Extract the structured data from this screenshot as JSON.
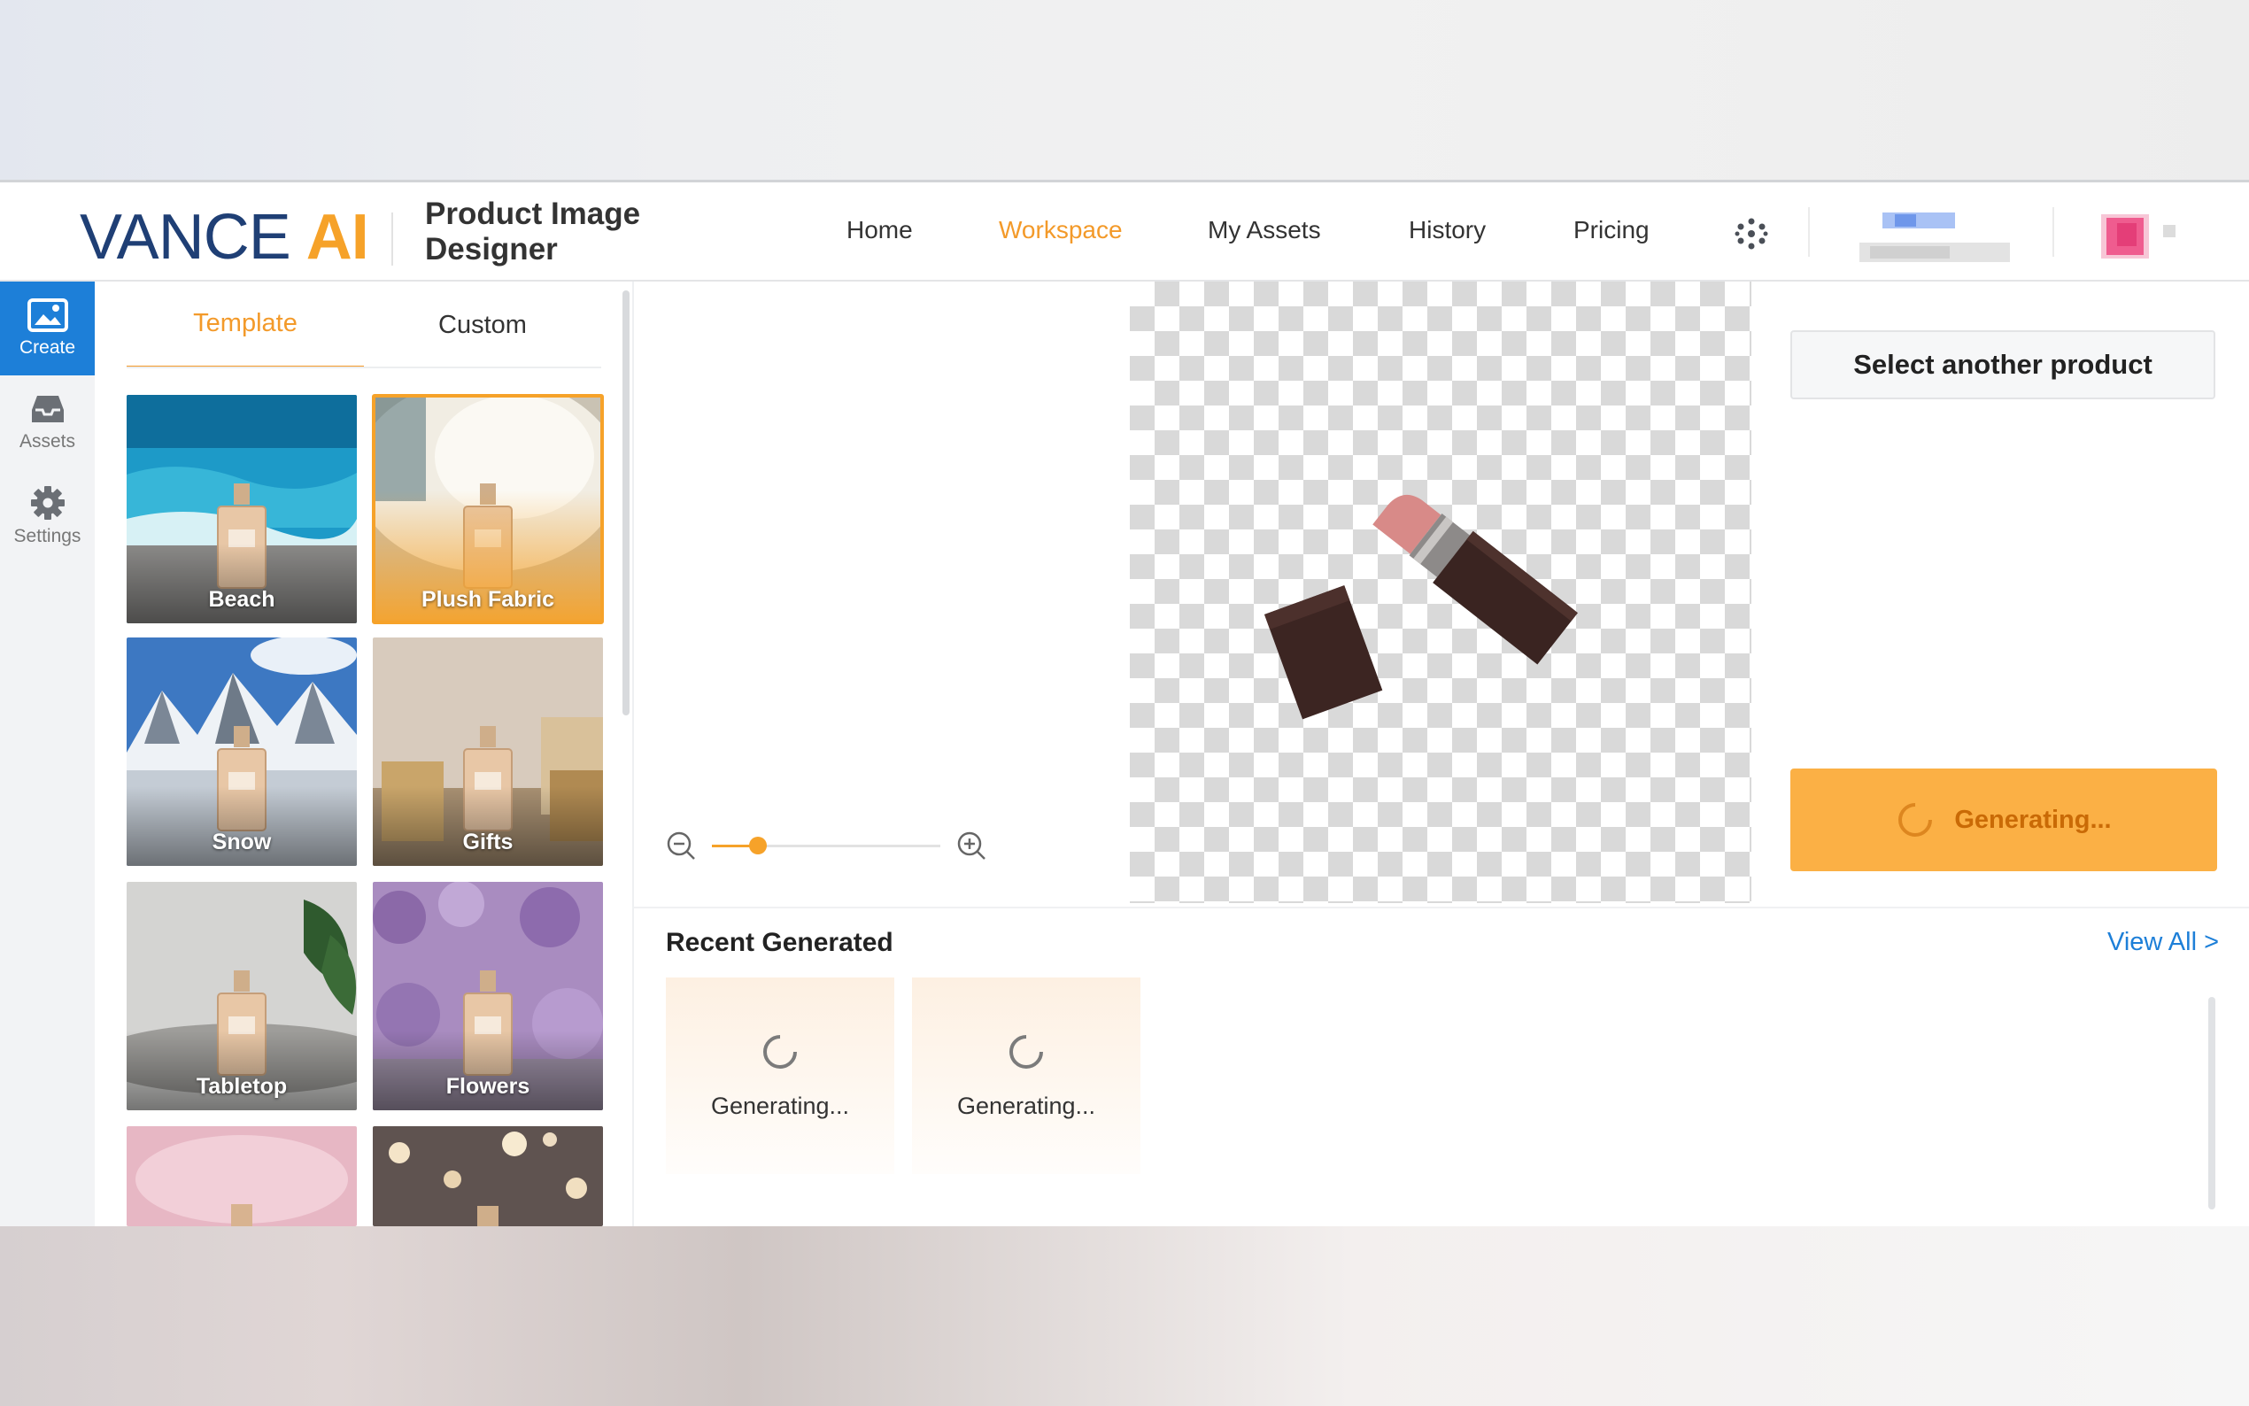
{
  "header": {
    "logo_main": "VANCE",
    "logo_accent": "AI",
    "product_title": "Product Image Designer",
    "nav": [
      {
        "label": "Home",
        "active": false
      },
      {
        "label": "Workspace",
        "active": true
      },
      {
        "label": "My Assets",
        "active": false
      },
      {
        "label": "History",
        "active": false
      },
      {
        "label": "Pricing",
        "active": false
      }
    ],
    "apps_icon": "grid-dots-icon"
  },
  "rail": {
    "items": [
      {
        "label": "Create",
        "icon": "image-icon",
        "active": true
      },
      {
        "label": "Assets",
        "icon": "inbox-icon",
        "active": false
      },
      {
        "label": "Settings",
        "icon": "gear-icon",
        "active": false
      }
    ]
  },
  "panel": {
    "tabs": [
      {
        "label": "Template",
        "active": true
      },
      {
        "label": "Custom",
        "active": false
      }
    ],
    "templates": [
      {
        "label": "Beach",
        "selected": false
      },
      {
        "label": "Plush Fabric",
        "selected": true
      },
      {
        "label": "Snow",
        "selected": false
      },
      {
        "label": "Gifts",
        "selected": false
      },
      {
        "label": "Tabletop",
        "selected": false
      },
      {
        "label": "Flowers",
        "selected": false
      },
      {
        "label": "",
        "selected": false
      },
      {
        "label": "",
        "selected": false
      }
    ]
  },
  "workspace": {
    "zoom_level": 0.2,
    "select_button": "Select another product",
    "generate_button": "Generating...",
    "recent_title": "Recent Generated",
    "view_all": "View All >",
    "recent_cards": [
      {
        "status": "Generating..."
      },
      {
        "status": "Generating..."
      }
    ]
  },
  "colors": {
    "accent": "#f39a2a",
    "brand_blue": "#1f3f75",
    "link_blue": "#1d7fd8",
    "generate_bg": "#fbb045"
  }
}
